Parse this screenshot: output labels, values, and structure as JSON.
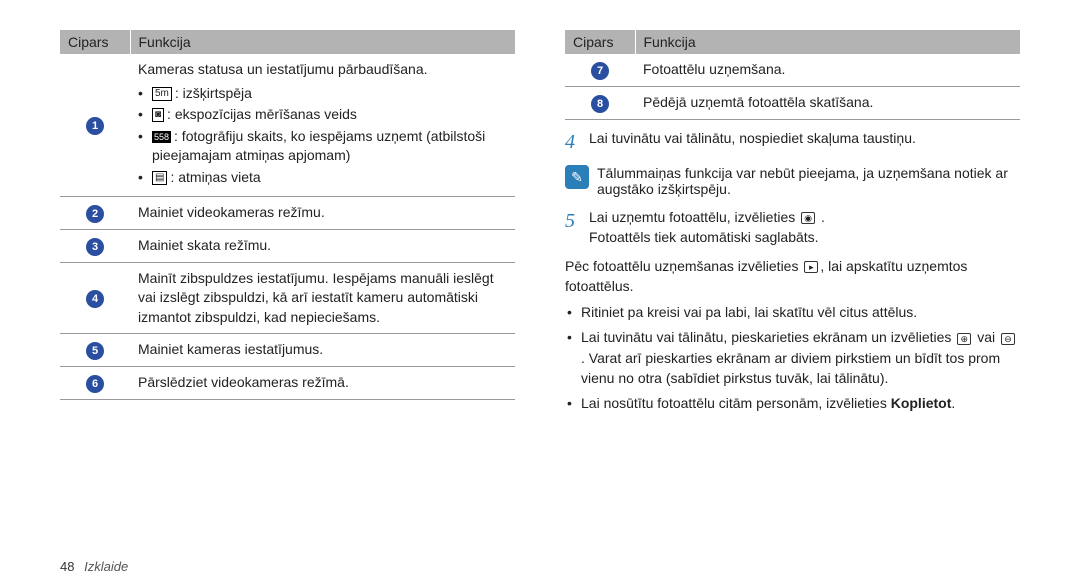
{
  "table_left": {
    "headers": [
      "Cipars",
      "Funkcija"
    ],
    "rows": [
      {
        "n": "1",
        "main": "Kameras statusa un iestatījumu pārbaudīšana.",
        "sub": [
          {
            "icon": "5m",
            "cls": "icon-box",
            "text": ": izšķirtspēja"
          },
          {
            "icon": "◙",
            "cls": "icon-box",
            "text": ": ekspozīcijas mērīšanas veids"
          },
          {
            "icon": "558",
            "cls": "icon-black",
            "text": ": fotogrāfiju skaits, ko iespējams uzņemt (atbilstoši pieejamajam atmiņas apjomam)"
          },
          {
            "icon": "▤",
            "cls": "icon-box",
            "text": ": atmiņas vieta"
          }
        ]
      },
      {
        "n": "2",
        "main": "Mainiet videokameras režīmu."
      },
      {
        "n": "3",
        "main": "Mainiet skata režīmu."
      },
      {
        "n": "4",
        "main": "Mainīt zibspuldzes iestatījumu. Iespējams manuāli ieslēgt vai izslēgt zibspuldzi, kā arī iestatīt kameru automātiski izmantot zibspuldzi, kad nepieciešams."
      },
      {
        "n": "5",
        "main": "Mainiet kameras iestatījumus."
      },
      {
        "n": "6",
        "main": "Pārslēdziet videokameras režīmā."
      }
    ]
  },
  "table_right": {
    "headers": [
      "Cipars",
      "Funkcija"
    ],
    "rows": [
      {
        "n": "7",
        "main": "Fotoattēlu uzņemšana."
      },
      {
        "n": "8",
        "main": "Pēdējā uzņemtā fotoattēla skatīšana."
      }
    ]
  },
  "steps": {
    "s4": "Lai tuvinātu vai tālinātu, nospiediet skaļuma taustiņu.",
    "note": "Tālummaiņas funkcija var nebūt pieejama, ja uzņemšana notiek ar augstāko izšķirtspēju.",
    "s5a": "Lai uzņemtu fotoattēlu, izvēlieties ",
    "s5b": "Fotoattēls tiek automātiski saglabāts."
  },
  "after_p1a": "Pēc fotoattēlu uzņemšanas izvēlieties ",
  "after_p1b": ", lai apskatītu uzņemtos fotoattēlus.",
  "bullets": {
    "b1": "Ritiniet pa kreisi vai pa labi, lai skatītu vēl citus attēlus.",
    "b2a": "Lai tuvinātu vai tālinātu, pieskarieties ekrānam un izvēlieties ",
    "b2mid": " vai ",
    "b2b": ". Varat arī pieskarties ekrānam ar diviem pirkstiem un bīdīt tos prom vienu no otra (sabīdiet pirkstus tuvāk, lai tālinātu).",
    "b3a": "Lai nosūtītu fotoattēlu citām personām, izvēlieties ",
    "b3bold": "Koplietot",
    "b3b": "."
  },
  "footer": {
    "page": "48",
    "section": "Izklaide"
  }
}
